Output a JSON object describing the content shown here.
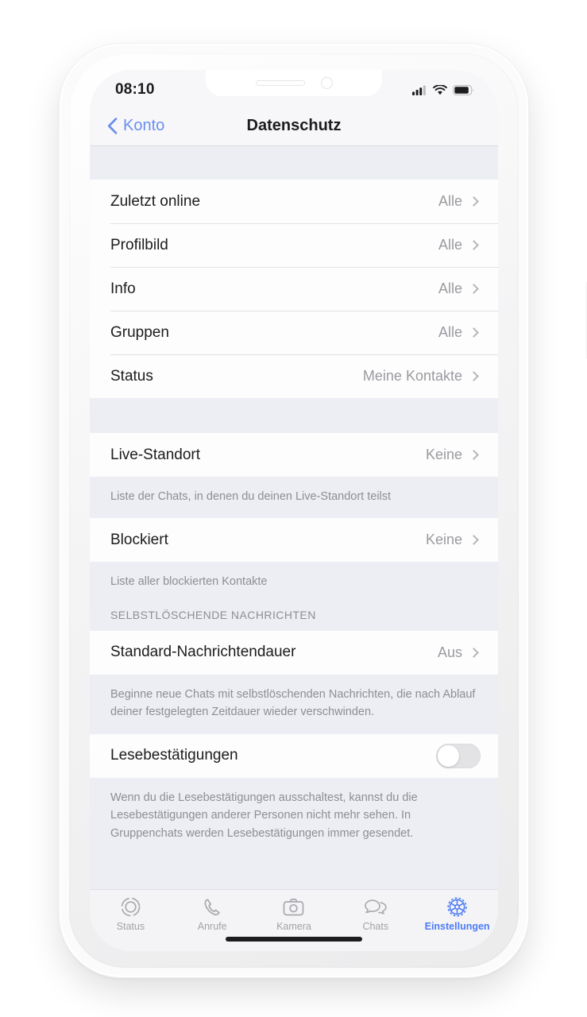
{
  "status_bar": {
    "time": "08:10",
    "icons": [
      "cellular-signal-icon",
      "wifi-icon",
      "battery-icon"
    ]
  },
  "nav": {
    "back_label": "Konto",
    "back_icon": "chevron-left-icon",
    "title": "Datenschutz"
  },
  "sections": [
    {
      "id": "privacy-visibility",
      "rows": [
        {
          "label": "Zuletzt online",
          "value": "Alle",
          "accessory": "chevron-right-icon"
        },
        {
          "label": "Profilbild",
          "value": "Alle",
          "accessory": "chevron-right-icon"
        },
        {
          "label": "Info",
          "value": "Alle",
          "accessory": "chevron-right-icon"
        },
        {
          "label": "Gruppen",
          "value": "Alle",
          "accessory": "chevron-right-icon"
        },
        {
          "label": "Status",
          "value": "Meine Kontakte",
          "accessory": "chevron-right-icon"
        }
      ]
    },
    {
      "id": "live-location",
      "row": {
        "label": "Live-Standort",
        "value": "Keine",
        "accessory": "chevron-right-icon"
      },
      "footer": "Liste der Chats, in denen du deinen Live-Standort teilst"
    },
    {
      "id": "blocked",
      "row": {
        "label": "Blockiert",
        "value": "Keine",
        "accessory": "chevron-right-icon"
      },
      "footer": "Liste aller blockierten Kontakte"
    },
    {
      "id": "disappearing-messages",
      "header": "SELBSTLÖSCHENDE NACHRICHTEN",
      "row": {
        "label": "Standard-Nachrichtendauer",
        "value": "Aus",
        "accessory": "chevron-right-icon"
      },
      "footer": "Beginne neue Chats mit selbstlöschenden Nachrichten, die nach Ablauf deiner festgelegten Zeitdauer wieder verschwinden."
    },
    {
      "id": "read-receipts",
      "row": {
        "label": "Lesebestätigungen",
        "toggle_state": "off"
      },
      "footer": "Wenn du die Lesebestätigungen ausschaltest, kannst du die Lesebestätigungen anderer Personen nicht mehr sehen. In Gruppenchats werden Lesebestätigungen immer gesendet."
    }
  ],
  "tab_bar": {
    "items": [
      {
        "label": "Status",
        "icon": "status-rings-icon",
        "active": false
      },
      {
        "label": "Anrufe",
        "icon": "phone-icon",
        "active": false
      },
      {
        "label": "Kamera",
        "icon": "camera-icon",
        "active": false
      },
      {
        "label": "Chats",
        "icon": "chat-bubbles-icon",
        "active": false
      },
      {
        "label": "Einstellungen",
        "icon": "gear-icon",
        "active": true
      }
    ]
  },
  "colors": {
    "accent_blue": "#4d7cf5",
    "back_blue": "#6c8fee",
    "section_bg": "#eceef3",
    "row_bg": "#fdfdfd",
    "secondary_text": "#8e8e93"
  },
  "home_indicator": "home-indicator-bar"
}
